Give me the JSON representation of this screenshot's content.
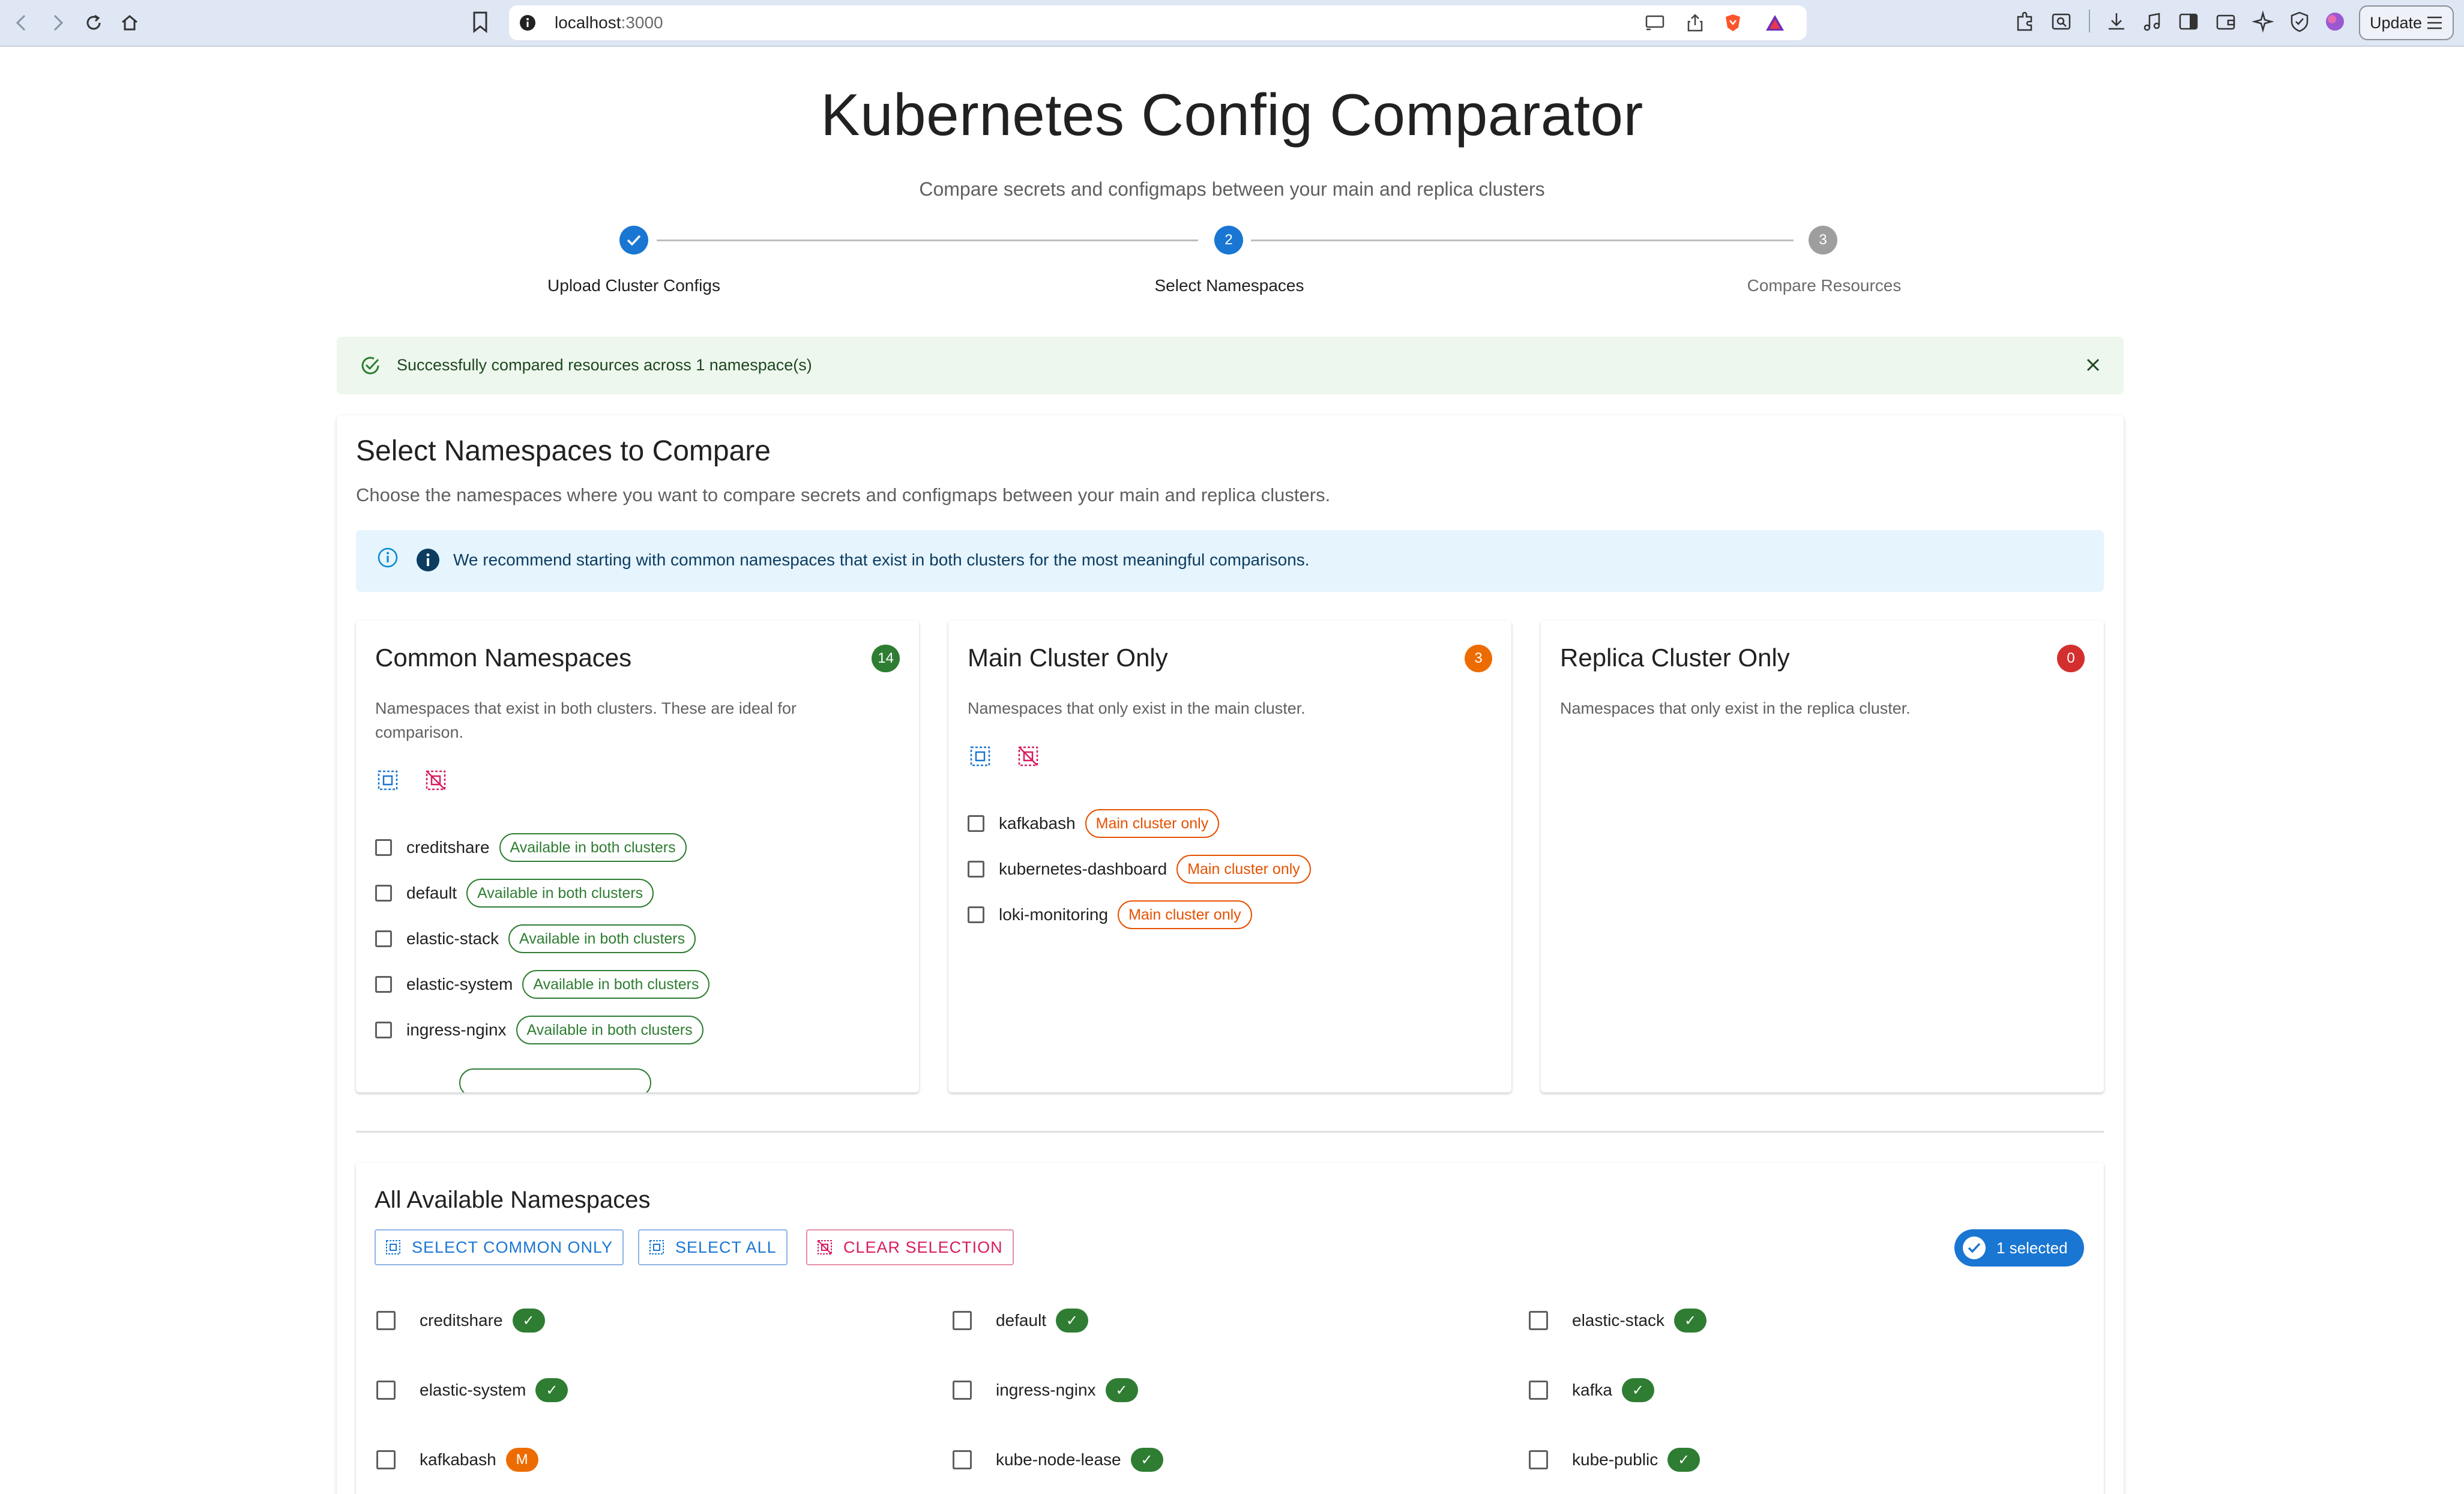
{
  "browser": {
    "url_host": "localhost",
    "url_port": ":3000",
    "update_label": "Update"
  },
  "page": {
    "title": "Kubernetes Config Comparator",
    "subtitle": "Compare secrets and configmaps between your main and replica clusters"
  },
  "stepper": {
    "steps": [
      {
        "label": "Upload Cluster Configs",
        "state": "completed",
        "icon": "check-icon"
      },
      {
        "label": "Select Namespaces",
        "number": "2",
        "state": "active"
      },
      {
        "label": "Compare Resources",
        "number": "3",
        "state": "pending"
      }
    ]
  },
  "alert": {
    "message": "Successfully compared resources across 1 namespace(s)",
    "type": "success"
  },
  "select_section": {
    "title": "Select Namespaces to Compare",
    "description": "Choose the namespaces where you want to compare secrets and configmaps between your main and replica clusters.",
    "info": "We recommend starting with common namespaces that exist in both clusters for the most meaningful comparisons."
  },
  "cards": {
    "common": {
      "title": "Common Namespaces",
      "count": "14",
      "description": "Namespaces that exist in both clusters. These are ideal for comparison.",
      "chip_label": "Available in both clusters",
      "items": [
        "creditshare",
        "default",
        "elastic-stack",
        "elastic-system",
        "ingress-nginx"
      ]
    },
    "main_only": {
      "title": "Main Cluster Only",
      "count": "3",
      "description": "Namespaces that only exist in the main cluster.",
      "chip_label": "Main cluster only",
      "items": [
        "kafkabash",
        "kubernetes-dashboard",
        "loki-monitoring"
      ]
    },
    "replica_only": {
      "title": "Replica Cluster Only",
      "count": "0",
      "description": "Namespaces that only exist in the replica cluster."
    }
  },
  "all_namespaces": {
    "title": "All Available Namespaces",
    "buttons": {
      "select_common": "SELECT COMMON ONLY",
      "select_all": "SELECT ALL",
      "clear": "CLEAR SELECTION"
    },
    "selected_label": "1 selected",
    "items": [
      {
        "name": "creditshare",
        "badge": "✓"
      },
      {
        "name": "default",
        "badge": "✓"
      },
      {
        "name": "elastic-stack",
        "badge": "✓"
      },
      {
        "name": "elastic-system",
        "badge": "✓"
      },
      {
        "name": "ingress-nginx",
        "badge": "✓"
      },
      {
        "name": "kafka",
        "badge": "✓"
      },
      {
        "name": "kafkabash",
        "badge": "M"
      },
      {
        "name": "kube-node-lease",
        "badge": "✓"
      },
      {
        "name": "kube-public",
        "badge": "✓"
      }
    ]
  },
  "colors": {
    "primary": "#1976d2",
    "success": "#2e7d32",
    "warning": "#ed6c02",
    "error": "#d32f2f",
    "pending": "#9e9e9e"
  }
}
